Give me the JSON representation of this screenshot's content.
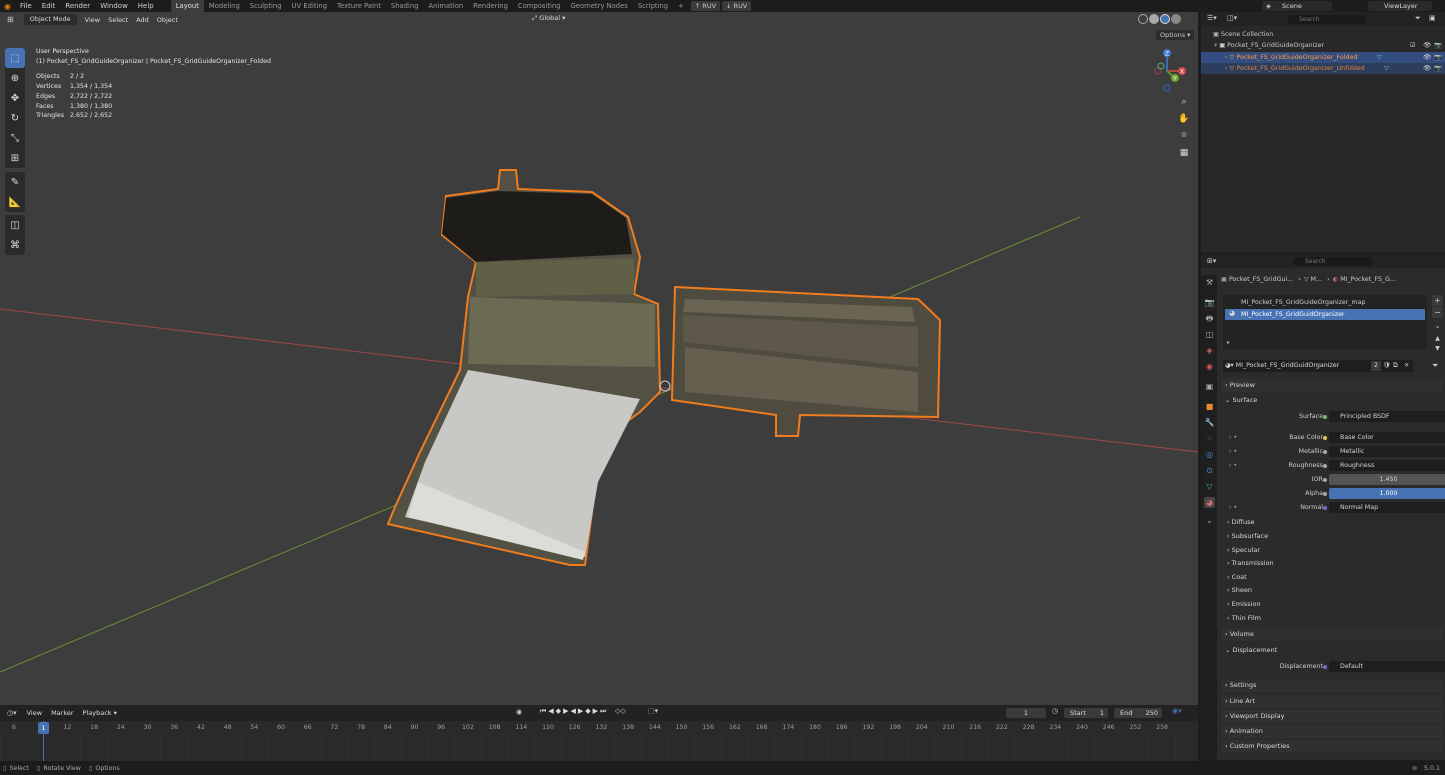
{
  "menu": [
    "File",
    "Edit",
    "Render",
    "Window",
    "Help"
  ],
  "workspaces": [
    "Layout",
    "Modeling",
    "Sculpting",
    "UV Editing",
    "Texture Paint",
    "Shading",
    "Animation",
    "Rendering",
    "Compositing",
    "Geometry Nodes",
    "Scripting"
  ],
  "workspace_add": "+",
  "ruv_buttons": [
    "RUV",
    "RUV"
  ],
  "scene_label": "Scene",
  "view_layer_label": "ViewLayer",
  "viewport": {
    "mode": "Object Mode",
    "menus": [
      "View",
      "Select",
      "Add",
      "Object"
    ],
    "transform_orientation": "Global",
    "options_label": "Options",
    "overlay_title": "User Perspective",
    "overlay_subtitle": "(1) Pocket_FS_GridGuideOrganizer | Pocket_FS_GridGuideOrganizer_Folded",
    "stats": [
      {
        "key": "Objects",
        "value": "2 / 2"
      },
      {
        "key": "Vertices",
        "value": "1,354 / 1,354"
      },
      {
        "key": "Edges",
        "value": "2,722 / 2,722"
      },
      {
        "key": "Faces",
        "value": "1,380 / 1,380"
      },
      {
        "key": "Triangles",
        "value": "2,652 / 2,652"
      }
    ],
    "gizmo_axes": {
      "x": "X",
      "y": "Y",
      "z": "Z"
    }
  },
  "outliner": {
    "search_placeholder": "Search",
    "root": "Scene Collection",
    "collection": "Pocket_FS_GridGuideOrganizer",
    "objects": [
      "Pocket_FS_GridGuideOrganizer_Folded",
      "Pocket_FS_GridGuideOrganizer_Unfolded"
    ]
  },
  "properties": {
    "search_placeholder": "Search",
    "breadcrumb": [
      "Pocket_FS_GridGui...",
      "M...",
      "MI_Pocket_FS_G..."
    ],
    "material_slots": [
      "MI_Pocket_FS_GridGuideOrganizer_map",
      "MI_Pocket_FS_GridGuidOrganizer"
    ],
    "material_name": "MI_Pocket_FS_GridGuidOrganizer",
    "user_count": "2",
    "preview": "Preview",
    "surface_section": "Surface",
    "surface_rows": [
      {
        "label": "Surface",
        "value": "Principled BSDF",
        "color": "#6ebf6e"
      },
      {
        "label": "Base Color",
        "value": "Base Color",
        "color": "#d8c94c"
      },
      {
        "label": "Metallic",
        "value": "Metallic",
        "color": "#a8a8a8"
      },
      {
        "label": "Roughness",
        "value": "Roughness",
        "color": "#a8a8a8"
      },
      {
        "label": "IOR",
        "value": "1.450",
        "color": "#a8a8a8"
      },
      {
        "label": "Alpha",
        "value": "1.000",
        "color": "#a8a8a8"
      },
      {
        "label": "Normal",
        "value": "Normal Map",
        "color": "#6d6dd6"
      }
    ],
    "sub_sections": [
      "Diffuse",
      "Subsurface",
      "Specular",
      "Transmission",
      "Coat",
      "Sheen",
      "Emission",
      "Thin Film"
    ],
    "volume": "Volume",
    "displacement_section": "Displacement",
    "displacement_row": {
      "label": "Displacement",
      "value": "Default",
      "color": "#6d6dd6"
    },
    "bottom_sections": [
      "Settings",
      "Line Art",
      "Viewport Display",
      "Animation",
      "Custom Properties"
    ]
  },
  "timeline": {
    "menus": [
      "View",
      "Marker",
      "Playback"
    ],
    "current_frame": "1",
    "start_label": "Start",
    "start": "1",
    "end_label": "End",
    "end": "250",
    "ticks": [
      "6",
      "6",
      "12",
      "18",
      "24",
      "30",
      "36",
      "42",
      "48",
      "54",
      "60",
      "66",
      "72",
      "78",
      "84",
      "90",
      "96",
      "102",
      "108",
      "114",
      "120",
      "126",
      "132",
      "138",
      "144",
      "150",
      "156",
      "162",
      "168",
      "174",
      "180",
      "186",
      "192",
      "198",
      "204",
      "210",
      "216",
      "222",
      "228",
      "234",
      "240",
      "246",
      "252",
      "258"
    ],
    "playhead": "1"
  },
  "status_bar": {
    "items": [
      "Select",
      "Rotate View",
      "Options"
    ],
    "version": "5.0.1"
  },
  "colors": {
    "accent": "#4772b3",
    "selection_orange": "#f07c1e",
    "x_axis": "#b34747",
    "y_axis": "#7aa33a"
  }
}
